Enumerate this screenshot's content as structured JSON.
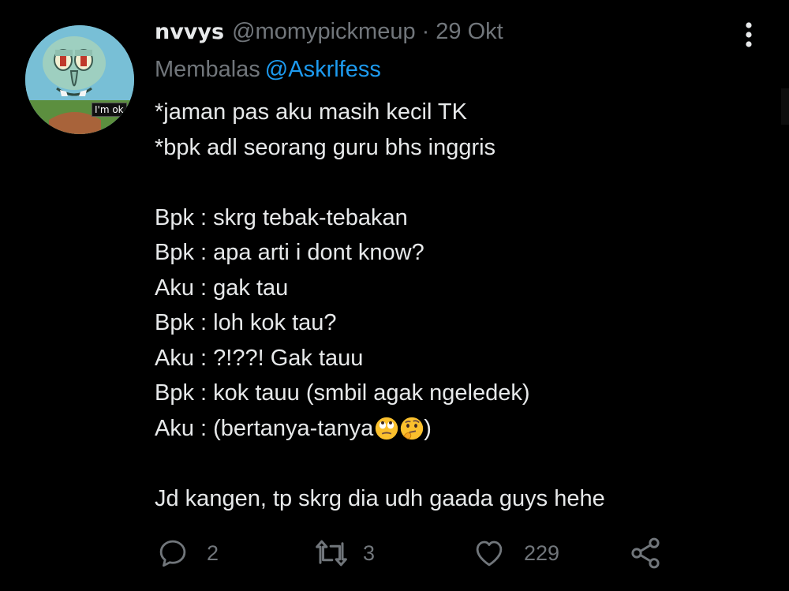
{
  "tweet": {
    "display_name": "nvvys",
    "handle": "@momypickmeup",
    "separator": "·",
    "date": "29 Okt",
    "reply_prefix": "Membalas",
    "reply_to": "@Askrlfess",
    "avatar_caption": "I'm ok",
    "lines": [
      "*jaman pas aku masih kecil TK",
      "*bpk adl seorang guru bhs inggris",
      "",
      "Bpk : skrg tebak-tebakan",
      "Bpk : apa arti i dont know?",
      "Aku : gak tau",
      "Bpk : loh kok tau?",
      "Aku : ?!??! Gak tauu",
      "Bpk : kok tauu (smbil agak ngeledek)",
      "Aku : (bertanya-tanya",
      "",
      "Jd kangen, tp skrg dia udh gaada guys hehe"
    ],
    "line_10_suffix": ")",
    "emojis": [
      "face-with-rolling-eyes-icon",
      "thinking-face-icon"
    ]
  },
  "actions": {
    "reply_count": "2",
    "retweet_count": "3",
    "like_count": "229"
  },
  "colors": {
    "background": "#000000",
    "text": "#e7e9ea",
    "muted": "#71767b",
    "accent": "#1d9bf0"
  }
}
